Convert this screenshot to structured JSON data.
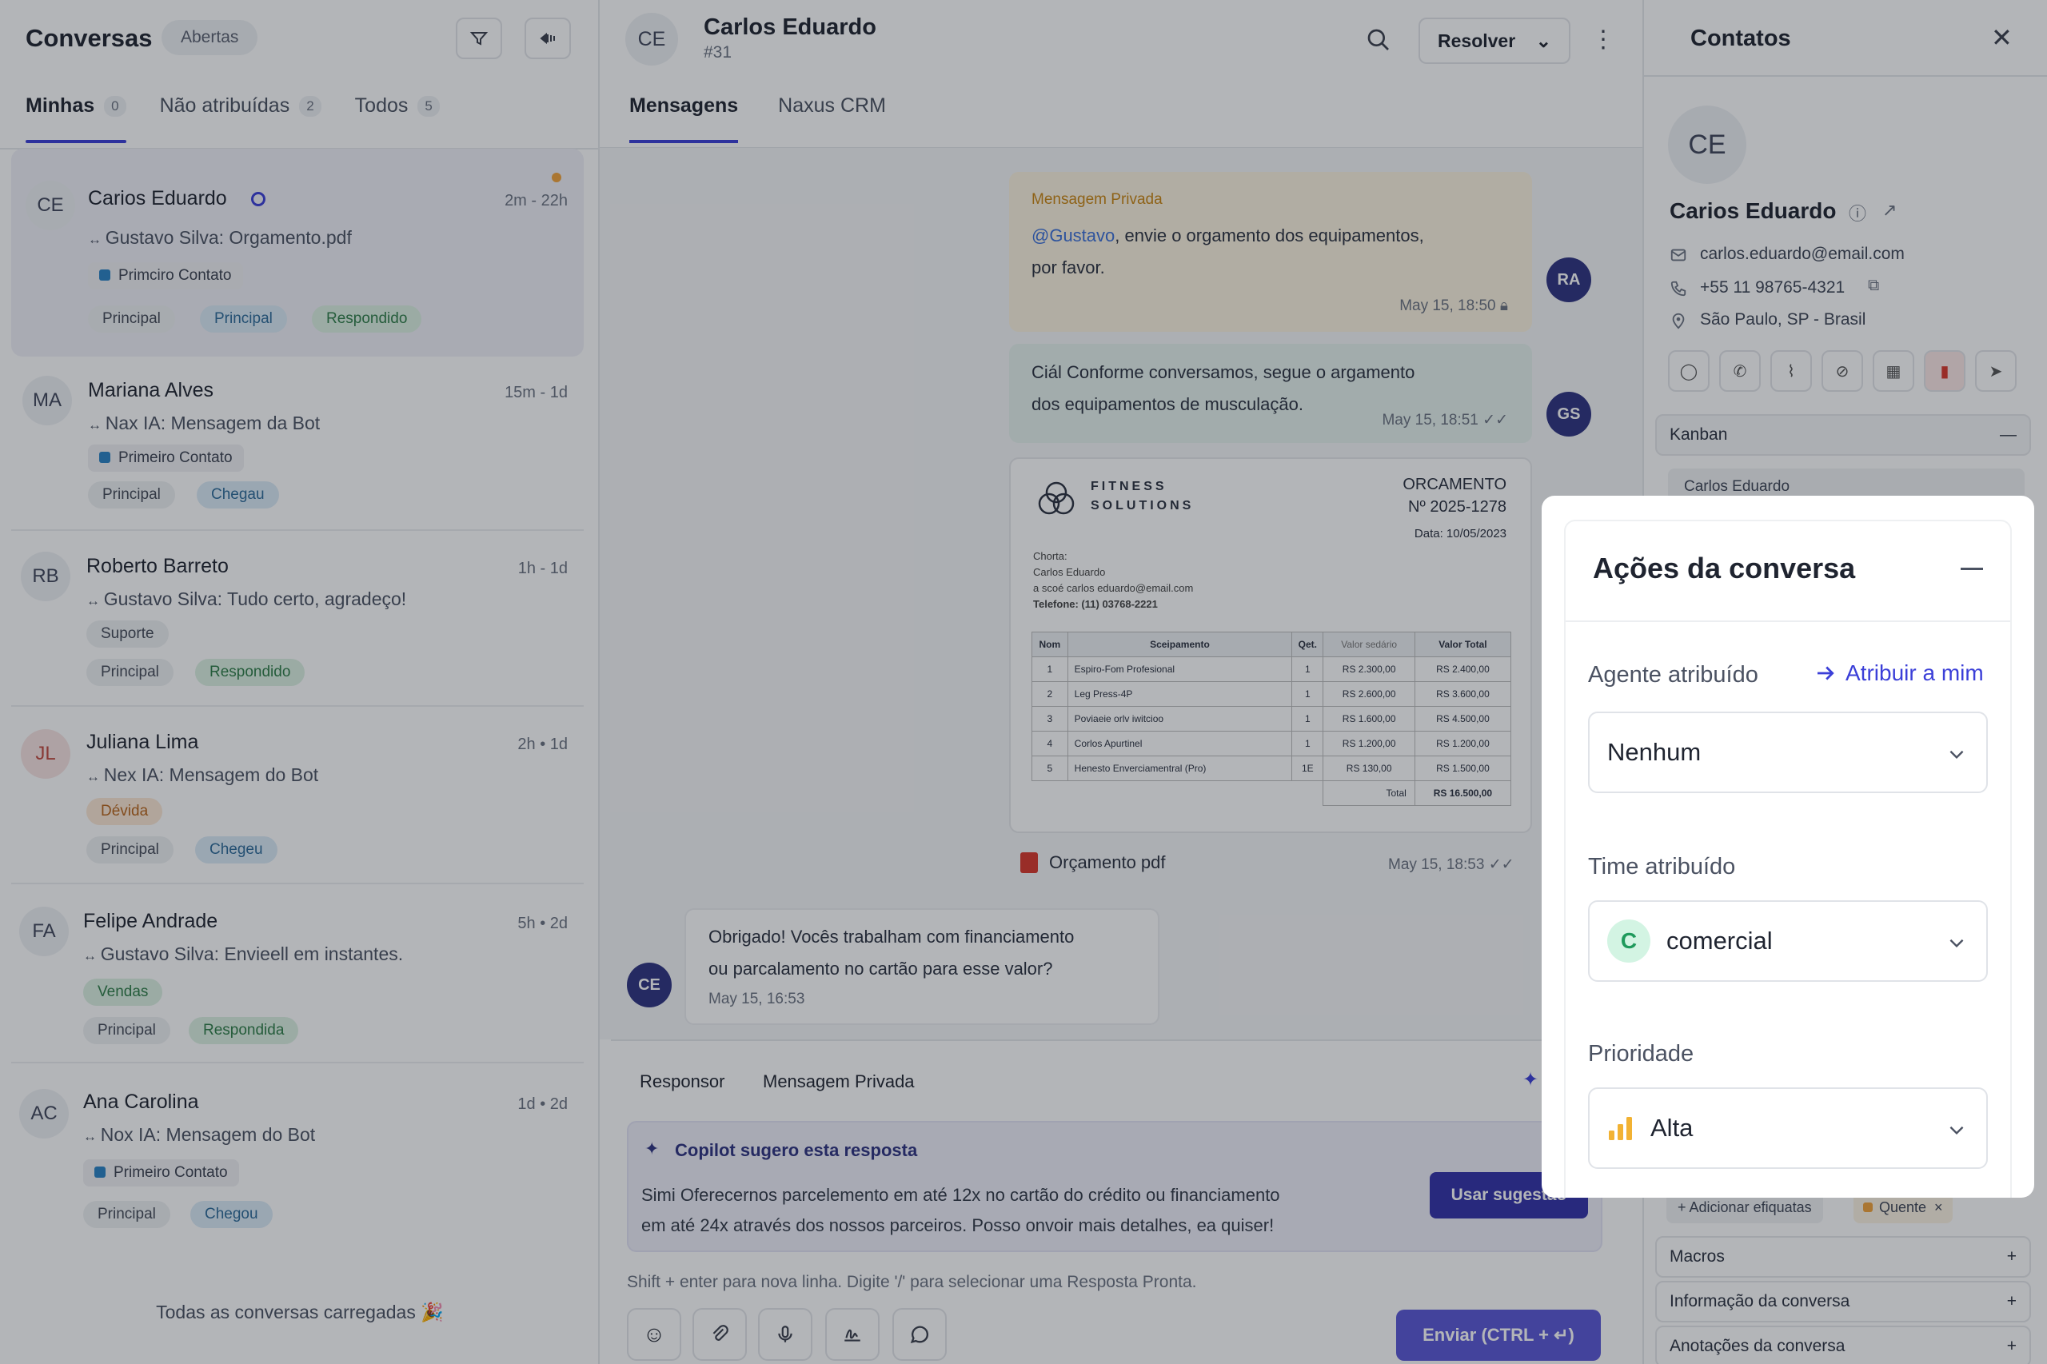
{
  "left": {
    "title": "Conversas",
    "status_filter": "Abertas",
    "tabs": [
      {
        "label": "Minhas",
        "count": "0"
      },
      {
        "label": "Não atribuídas",
        "count": "2"
      },
      {
        "label": "Todos",
        "count": "5"
      }
    ],
    "conversations": [
      {
        "initials": "CE",
        "name": "Carios Eduardo",
        "time": "2m - 22h",
        "preview": "Gustavo Silva: Orgamento.pdf",
        "label": "Primciro Contato",
        "tags": [
          "Principal",
          "Principal",
          "Respondido"
        ]
      },
      {
        "initials": "MA",
        "name": "Mariana Alves",
        "time": "15m - 1d",
        "preview": "Nax IA: Mensagem da Bot",
        "label": "Primeiro Contato",
        "tags": [
          "Principal",
          "Chegau"
        ]
      },
      {
        "initials": "RB",
        "name": "Roberto Barreto",
        "time": "1h - 1d",
        "preview": "Gustavo Silva: Tudo certo, agradeço!",
        "label": "Suporte",
        "tags": [
          "Principal",
          "Respondido"
        ]
      },
      {
        "initials": "JL",
        "name": "Juliana Lima",
        "time": "2h • 1d",
        "preview": "Nex IA: Mensagem do Bot",
        "label": "Dévida",
        "tags": [
          "Principal",
          "Chegeu"
        ]
      },
      {
        "initials": "FA",
        "name": "Felipe Andrade",
        "time": "5h • 2d",
        "preview": "Gustavo Silva: Envieell em instantes.",
        "label": "Vendas",
        "tags": [
          "Principal",
          "Respondida"
        ]
      },
      {
        "initials": "AC",
        "name": "Ana Carolina",
        "time": "1d • 2d",
        "preview": "Nox IA: Mensagem do Bot",
        "label": "Primeiro Contato",
        "tags": [
          "Principal",
          "Chegou"
        ]
      }
    ],
    "footer": "Todas as conversas carregadas 🎉"
  },
  "center": {
    "contact_initials": "CE",
    "contact_name": "Carlos Eduardo",
    "conversation_number": "#31",
    "resolve_label": "Resolver",
    "tabs": [
      "Mensagens",
      "Naxus CRM"
    ],
    "messages": {
      "private_label": "Mensagem Privada",
      "private_mention": "@Gustavo",
      "private_text": ", envie o orgamento dos equipamentos,",
      "private_text2": "por favor.",
      "private_time": "May 15, 18:50",
      "private_sender": "RA",
      "out_text": "Ciál Conforme conversamos, segue o argamento",
      "out_text2": "dos equipamentos de musculação.",
      "out_time": "May 15, 18:51",
      "out_sender": "GS",
      "doc_time": "May 15, 18:53",
      "doc_sender": "GS",
      "attachment_name": "Orçamento pdf",
      "in_text": "Obrigado! Vocês trabalham com financiamento",
      "in_text2": "ou parcalamento no cartão para esse valor?",
      "in_time": "May 15, 16:53",
      "in_sender": "CE"
    },
    "document": {
      "brand1": "FITNESS",
      "brand2": "SOLUTIONS",
      "heading": "ORCAMENTO",
      "number": "Nº 2025-1278",
      "date": "Data: 10/05/2023",
      "client_label": "Chorta:",
      "client_name": "Carlos Eduardo",
      "client_email": "a scoé carlos eduardo@email.com",
      "client_phone": "Telefone: (11) 03768-2221",
      "columns": [
        "Nom",
        "Sceipamento",
        "Qet.",
        "Valor sedário",
        "Valor Total"
      ],
      "rows": [
        [
          "1",
          "Espiro-Fom Profesional",
          "1",
          "RS 2.300,00",
          "RS 2.400,00"
        ],
        [
          "2",
          "Leg Press-4P",
          "1",
          "RS 2.600,00",
          "RS 3.600,00"
        ],
        [
          "3",
          "Poviaeie orlv iwitcioo",
          "1",
          "RS 1.600,00",
          "RS 4.500,00"
        ],
        [
          "4",
          "Corlos Apurtinel",
          "1",
          "RS 1.200,00",
          "RS 1.200,00"
        ],
        [
          "5",
          "Henesto Enverciamentral (Pro)",
          "1E",
          "RS 130,00",
          "RS 1.500,00"
        ]
      ],
      "total_label": "Total",
      "total_value": "RS 16.500,00"
    },
    "composer": {
      "tab_reply": "Responsor",
      "tab_private": "Mensagem Privada",
      "copilot_title": "Copilot sugero esta resposta",
      "copilot_text1": "Simi Oferecernos parcelemento em até 12x no cartão do crédito ou financiamento",
      "copilot_text2": "em até 24x através dos nossos parceiros. Posso onvoir mais detalhes, ea quiser!",
      "use_suggestion": "Usar sugestão",
      "hint": "Shift + enter para nova linha. Digite '/' para selecionar uma Resposta Pronta.",
      "send_label": "Enviar (CTRL + ↵)"
    }
  },
  "right": {
    "title": "Contatos",
    "initials": "CE",
    "name": "Carios Eduardo",
    "email": "carlos.eduardo@email.com",
    "phone": "+55 11 98765-4321",
    "location": "São Paulo, SP - Brasil",
    "kanban_label": "Kanban",
    "kanban_card": "Carlos Eduardo",
    "add_tags": "Adicionar efiquatas",
    "tag_hot": "Quente",
    "sections": [
      "Macros",
      "Informação da conversa",
      "Anotações da conversa"
    ]
  },
  "modal": {
    "title": "Ações da conversa",
    "agent_label": "Agente atribuído",
    "assign_me": "Atribuir a mim",
    "agent_value": "Nenhum",
    "team_label": "Time atribuído",
    "team_initial": "C",
    "team_value": "comercial",
    "priority_label": "Prioridade",
    "priority_value": "Alta"
  },
  "colors": {
    "accent": "#3b3fd8",
    "overlay": "rgba(20,24,34,0.32)",
    "priority": "#f2b233"
  }
}
